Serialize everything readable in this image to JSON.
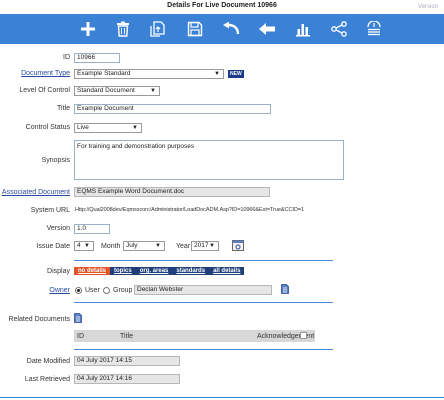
{
  "title": "Details For Live Document 10966",
  "version_label": "Version",
  "toolbar": {
    "buttons": [
      {
        "name": "add",
        "icon": "plus-icon"
      },
      {
        "name": "delete",
        "icon": "trash-icon"
      },
      {
        "name": "clone",
        "icon": "copy-icon"
      },
      {
        "name": "save",
        "icon": "save-icon"
      },
      {
        "name": "undo",
        "icon": "undo-icon"
      },
      {
        "name": "back",
        "icon": "arrow-left-icon"
      },
      {
        "name": "reports",
        "icon": "bar-chart-icon"
      },
      {
        "name": "share",
        "icon": "share-icon"
      },
      {
        "name": "history",
        "icon": "history-list-icon"
      }
    ]
  },
  "form": {
    "id_label": "ID",
    "id_value": "10966",
    "doc_type_label": "Document Type",
    "doc_type_value": "Example Standard",
    "new_badge": "NEW",
    "level_label": "Level Of Control",
    "level_value": "Standard Document",
    "title_label": "Title",
    "title_value": "Example Document",
    "control_status_label": "Control Status",
    "control_status_value": "Live",
    "synopsis_label": "Synopsis",
    "synopsis_value": "For training and demonstration purposes",
    "assoc_doc_label": "Associated Document",
    "assoc_doc_value": "EQMS Example Word Document.doc",
    "system_url_label": "System URL",
    "system_url_value": "Http://Qual2008dev/Eqmsscorc/Administrator/LoadDocADM.Asp?ID=10966&Ext=True&CCID=1",
    "version_label": "Version",
    "version_value": "1.0",
    "issue_date_label": "Issue Date",
    "day_value": "4",
    "month_label": "Month",
    "month_value": "July",
    "year_label": "Year",
    "year_value": "2017",
    "display_label": "Display",
    "display_tabs": [
      "no details",
      "topics",
      "org. areas",
      "standards",
      "all details"
    ],
    "owner_label": "Owner",
    "owner_user_label": "User",
    "owner_group_label": "Group",
    "owner_value": "Declan Webster",
    "related_label": "Related Documents",
    "related_cols": [
      "ID",
      "Title",
      "Acknowledgement"
    ],
    "date_modified_label": "Date Modified",
    "date_modified_value": "04 July 2017 14:15",
    "last_retrieved_label": "Last Retrieved",
    "last_retrieved_value": "04 July 2017 14:16"
  },
  "colors": {
    "toolbar": "#3b82d6",
    "display_bar": "#1f3f7a",
    "display_active": "#e2542a",
    "link": "#2a4aa0"
  }
}
